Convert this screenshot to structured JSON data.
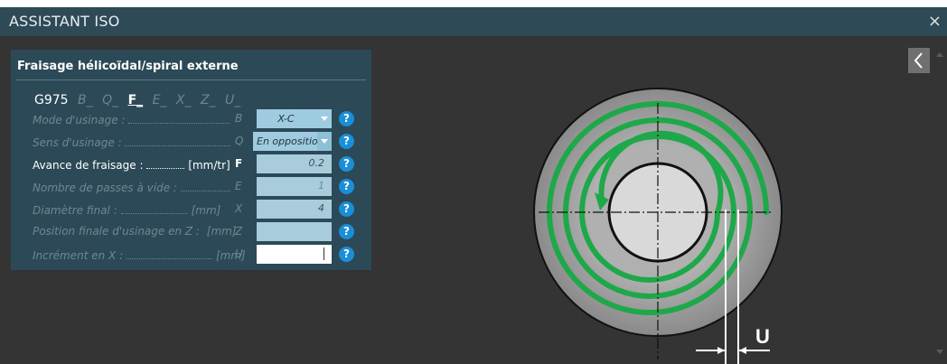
{
  "window": {
    "title": "ASSISTANT ISO",
    "close_glyph": "×"
  },
  "panel": {
    "title": "Fraisage hélicoïdal/spiral externe",
    "gcode": {
      "cmd": "G975",
      "letters": [
        "B_",
        "Q_",
        "F_",
        "E_",
        "X_",
        "Z_",
        "U_"
      ],
      "active": "F_"
    },
    "params": [
      {
        "label": "Mode d'usinage :",
        "unit": "",
        "code": "B",
        "value": "X-C",
        "kind": "dropdown",
        "active": false
      },
      {
        "label": "Sens d'usinage :",
        "unit": "",
        "code": "Q",
        "value": "En opposition",
        "kind": "dropdown",
        "active": false
      },
      {
        "label": "Avance de fraisage :",
        "unit": "[mm/tr]",
        "code": "F",
        "value": "0.2",
        "kind": "input",
        "active": true
      },
      {
        "label": "Nombre de passes à vide :",
        "unit": "",
        "code": "E",
        "value": "1",
        "kind": "input",
        "active": false
      },
      {
        "label": "Diamètre final :",
        "unit": "[mm]",
        "code": "X",
        "value": "4",
        "kind": "input",
        "active": false
      },
      {
        "label": "Position finale d'usinage en Z :",
        "unit": "[mm]",
        "code": "Z",
        "value": "",
        "kind": "input",
        "active": false
      },
      {
        "label": "Incrément en X :",
        "unit": "[mm]",
        "code": "U",
        "value": "",
        "kind": "input",
        "active": false
      }
    ],
    "help_glyph": "?"
  },
  "nav": {
    "back_glyph": "‹"
  },
  "diagram": {
    "dimension_label": "U",
    "colors": {
      "spiral": "#1fa84a",
      "disc": "#9a9a9a",
      "core": "#d9d9d9"
    }
  }
}
